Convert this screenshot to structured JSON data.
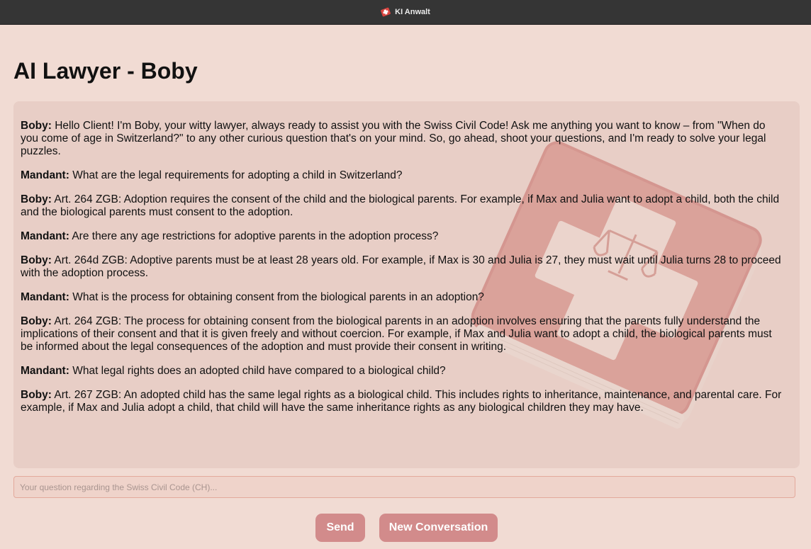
{
  "window": {
    "title": "KI Anwalt",
    "icon": "swiss-law-book-icon"
  },
  "page": {
    "title": "AI Lawyer - Boby"
  },
  "chat": {
    "background_image": "swiss-law-book-watermark",
    "messages": [
      {
        "sender": "Boby:",
        "text": " Hello Client! I'm Boby, your witty lawyer, always ready to assist you with the Swiss Civil Code! Ask me anything you want to know – from \"When do you come of age in Switzerland?\" to any other curious question that's on your mind. So, go ahead, shoot your questions, and I'm ready to solve your legal puzzles."
      },
      {
        "sender": "Mandant:",
        "text": " What are the legal requirements for adopting a child in Switzerland?"
      },
      {
        "sender": "Boby:",
        "text": " Art. 264 ZGB: Adoption requires the consent of the child and the biological parents. For example, if Max and Julia want to adopt a child, both the child and the biological parents must consent to the adoption."
      },
      {
        "sender": "Mandant:",
        "text": " Are there any age restrictions for adoptive parents in the adoption process?"
      },
      {
        "sender": "Boby:",
        "text": " Art. 264d ZGB: Adoptive parents must be at least 28 years old. For example, if Max is 30 and Julia is 27, they must wait until Julia turns 28 to proceed with the adoption process."
      },
      {
        "sender": "Mandant:",
        "text": " What is the process for obtaining consent from the biological parents in an adoption?"
      },
      {
        "sender": "Boby:",
        "text": " Art. 264 ZGB: The process for obtaining consent from the biological parents in an adoption involves ensuring that the parents fully understand the implications of their consent and that it is given freely and without coercion. For example, if Max and Julia want to adopt a child, the biological parents must be informed about the legal consequences of the adoption and must provide their consent in writing."
      },
      {
        "sender": "Mandant:",
        "text": " What legal rights does an adopted child have compared to a biological child?"
      },
      {
        "sender": "Boby:",
        "text": " Art. 267 ZGB: An adopted child has the same legal rights as a biological child. This includes rights to inheritance, maintenance, and parental care. For example, if Max and Julia adopt a child, that child will have the same inheritance rights as any biological children they may have."
      }
    ]
  },
  "input": {
    "placeholder": "Your question regarding the Swiss Civil Code (CH)...",
    "value": ""
  },
  "buttons": {
    "send_label": "Send",
    "new_conversation_label": "New Conversation"
  },
  "colors": {
    "background": "#f1dbd3",
    "panel": "#e8cec6",
    "button": "#d28b8b",
    "titlebar": "#353535"
  }
}
